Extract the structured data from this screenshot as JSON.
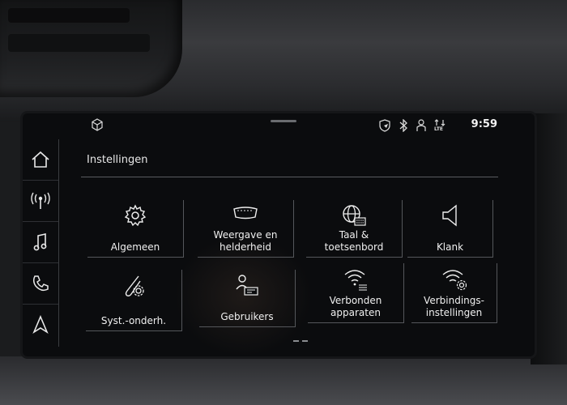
{
  "status_bar": {
    "time": "9:59",
    "left_icon": "cube-icon",
    "icons": [
      "navigation-shield-icon",
      "bluetooth-icon",
      "user-icon",
      "lte-signal-icon"
    ],
    "lte_label": "LTE"
  },
  "side_nav": {
    "items": [
      {
        "icon": "home-icon"
      },
      {
        "icon": "radio-broadcast-icon"
      },
      {
        "icon": "music-note-icon"
      },
      {
        "icon": "phone-icon"
      },
      {
        "icon": "navigation-arrow-icon"
      }
    ]
  },
  "page": {
    "title": "Instellingen"
  },
  "tiles": [
    {
      "icon": "gear-icon",
      "line1": "Algemeen",
      "line2": ""
    },
    {
      "icon": "display-brightness-icon",
      "line1": "Weergave en",
      "line2": "helderheid"
    },
    {
      "icon": "globe-keyboard-icon",
      "line1": "Taal &",
      "line2": "toetsenbord"
    },
    {
      "icon": "speaker-icon",
      "line1": "Klank",
      "line2": ""
    },
    {
      "icon": "wrench-gear-icon",
      "line1": "Syst.-onderh.",
      "line2": ""
    },
    {
      "icon": "user-card-icon",
      "line1": "Gebruikers",
      "line2": ""
    },
    {
      "icon": "wifi-list-icon",
      "line1": "Verbonden",
      "line2": "apparaten"
    },
    {
      "icon": "wifi-gear-icon",
      "line1": "Verbindings-",
      "line2": "instellingen"
    }
  ],
  "colors": {
    "screen_bg": "#0b0c0e",
    "text": "#f0f0f0",
    "divider": "#55575b"
  }
}
